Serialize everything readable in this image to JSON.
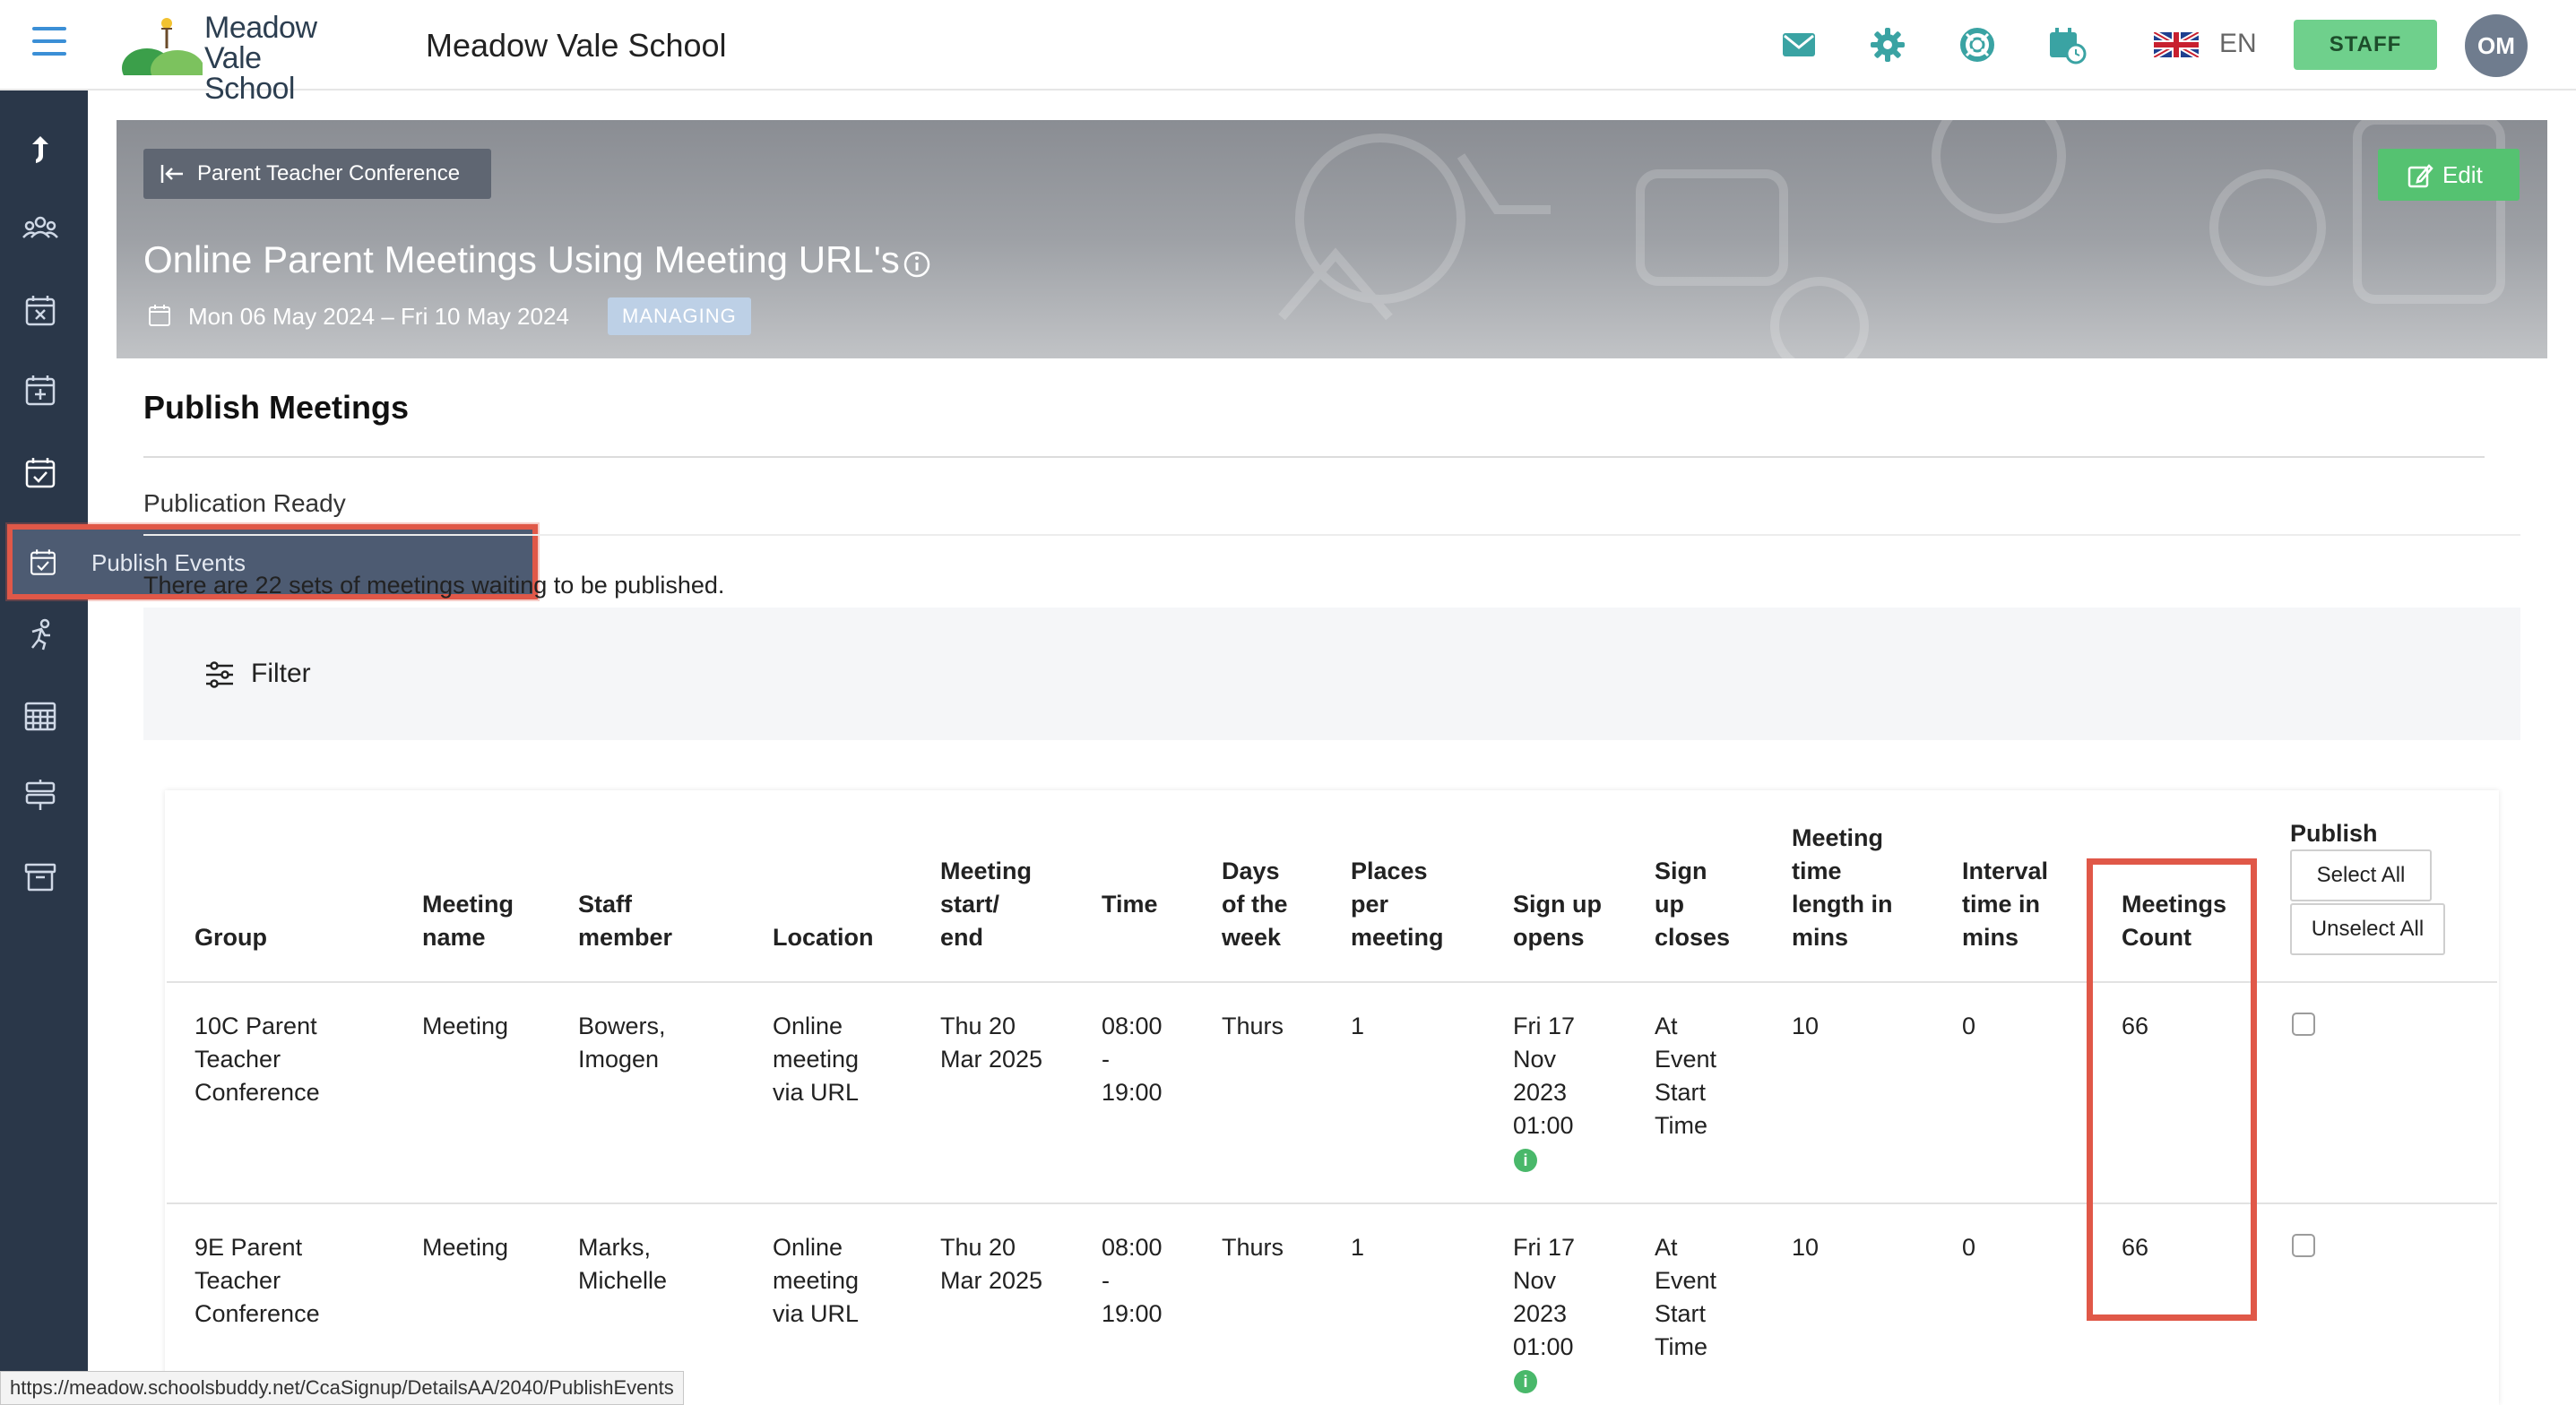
{
  "header": {
    "logo_line1": "Meadow",
    "logo_line2": "Vale School",
    "school_name": "Meadow Vale School",
    "language": "EN",
    "staff_label": "STAFF",
    "avatar_initials": "OM"
  },
  "sidebar": {
    "tooltip": "Publish Events",
    "icons": [
      "share-icon",
      "people-icon",
      "calendar-x-icon",
      "calendar-plus-icon",
      "calendar-check-icon",
      "table-icon",
      "activity-icon",
      "grid-calendar-icon",
      "signpost-icon",
      "archive-icon"
    ]
  },
  "banner": {
    "back_label": "Parent Teacher Conference",
    "edit_label": "Edit",
    "title": "Online Parent Meetings Using Meeting URL's",
    "dates": "Mon 06 May 2024 – Fri 10 May 2024",
    "badge": "MANAGING"
  },
  "content": {
    "section_title": "Publish Meetings",
    "publication_ready": "Publication Ready",
    "waiting_text": "There are 22 sets of meetings waiting to be published.",
    "filter_label": "Filter"
  },
  "table": {
    "headers": {
      "group": "Group",
      "meeting_name": [
        "Meeting",
        "name"
      ],
      "staff_member": [
        "Staff",
        "member"
      ],
      "location": "Location",
      "meeting_start_end": [
        "Meeting",
        "start/",
        "end"
      ],
      "time": "Time",
      "days": [
        "Days",
        "of the",
        "week"
      ],
      "places": [
        "Places",
        "per",
        "meeting"
      ],
      "signup_opens": [
        "Sign up",
        "opens"
      ],
      "signup_closes": [
        "Sign",
        "up",
        "closes"
      ],
      "time_length": [
        "Meeting",
        "time",
        "length in",
        "mins"
      ],
      "interval": [
        "Interval",
        "time in",
        "mins"
      ],
      "meetings_count": [
        "Meetings",
        "Count"
      ],
      "publish": "Publish"
    },
    "select_all": "Select All",
    "unselect_all": "Unselect All",
    "rows": [
      {
        "group": [
          "10C Parent",
          "Teacher",
          "Conference"
        ],
        "meeting_name": "Meeting",
        "staff": [
          "Bowers,",
          "Imogen"
        ],
        "location": [
          "Online",
          "meeting",
          "via URL"
        ],
        "start_end": [
          "Thu 20",
          "Mar 2025"
        ],
        "time": [
          "08:00",
          "-",
          "19:00"
        ],
        "days": "Thurs",
        "places": "1",
        "signup_opens": [
          "Fri 17",
          "Nov",
          "2023",
          "01:00"
        ],
        "signup_closes": [
          "At",
          "Event",
          "Start",
          "Time"
        ],
        "length": "10",
        "interval": "0",
        "count": "66",
        "checked": false
      },
      {
        "group": [
          "9E Parent",
          "Teacher",
          "Conference"
        ],
        "meeting_name": "Meeting",
        "staff": [
          "Marks,",
          "Michelle"
        ],
        "location": [
          "Online",
          "meeting",
          "via URL"
        ],
        "start_end": [
          "Thu 20",
          "Mar 2025"
        ],
        "time": [
          "08:00",
          "-",
          "19:00"
        ],
        "days": "Thurs",
        "places": "1",
        "signup_opens": [
          "Fri 17",
          "Nov",
          "2023",
          "01:00"
        ],
        "signup_closes": [
          "At",
          "Event",
          "Start",
          "Time"
        ],
        "length": "10",
        "interval": "0",
        "count": "66",
        "checked": false
      }
    ]
  },
  "status_url": "https://meadow.schoolsbuddy.net/CcaSignup/DetailsAA/2040/PublishEvents",
  "colors": {
    "sidebar": "#2a3749",
    "accent_blue": "#3b8fd6",
    "staff_green": "#6fd08c",
    "edit_green": "#55c271",
    "highlight_red": "#e05848",
    "managing_badge": "#bdd0e6"
  }
}
